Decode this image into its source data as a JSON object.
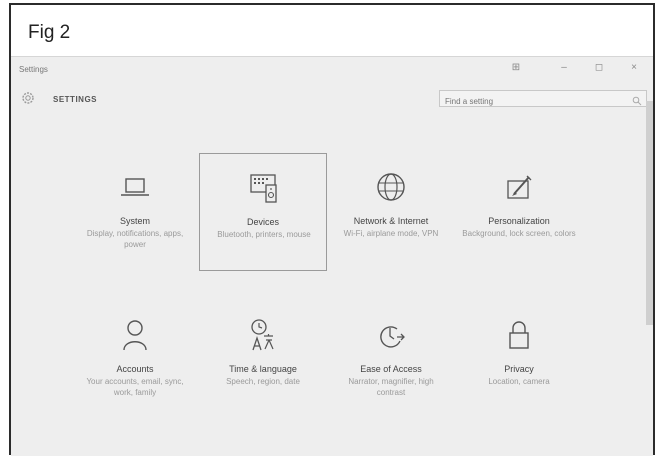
{
  "figure": {
    "label": "Fig 2"
  },
  "window": {
    "app_title": "Settings",
    "controls": {
      "pin": "⊞",
      "minimize": "–",
      "maximize": "◻",
      "close": "×"
    }
  },
  "header": {
    "title": "SETTINGS",
    "search_placeholder": "Find a setting"
  },
  "tiles": [
    {
      "name": "System",
      "desc": "Display, notifications, apps, power",
      "icon": "laptop-icon"
    },
    {
      "name": "Devices",
      "desc": "Bluetooth, printers, mouse",
      "icon": "devices-icon"
    },
    {
      "name": "Network & Internet",
      "desc": "Wi-Fi, airplane mode, VPN",
      "icon": "globe-icon"
    },
    {
      "name": "Personalization",
      "desc": "Background, lock screen, colors",
      "icon": "paint-icon"
    },
    {
      "name": "Accounts",
      "desc": "Your accounts, email, sync, work, family",
      "icon": "person-icon"
    },
    {
      "name": "Time & language",
      "desc": "Speech, region, date",
      "icon": "time-language-icon"
    },
    {
      "name": "Ease of Access",
      "desc": "Narrator, magnifier, high contrast",
      "icon": "ease-of-access-icon"
    },
    {
      "name": "Privacy",
      "desc": "Location, camera",
      "icon": "lock-icon"
    }
  ],
  "colors": {
    "window_bg": "#eeeeee",
    "frame": "#2b2b2b",
    "selected_border": "#9a9a9a"
  }
}
